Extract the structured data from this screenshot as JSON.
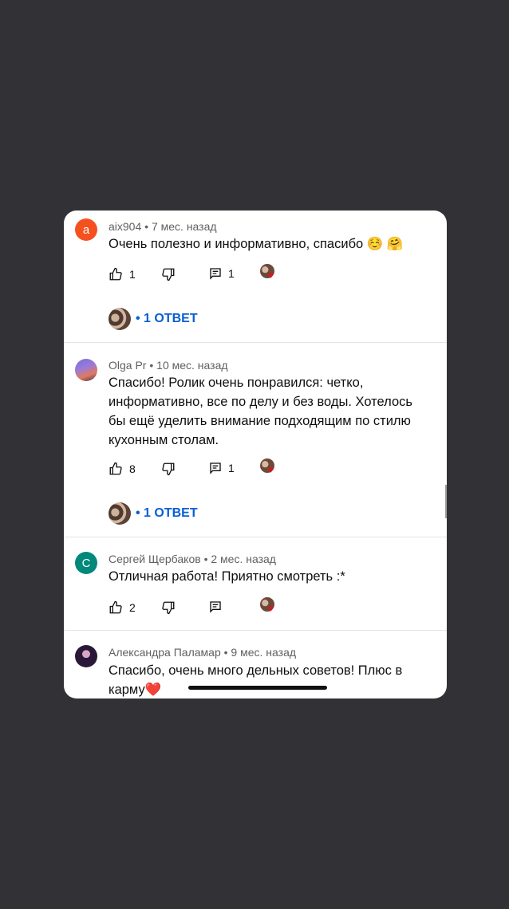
{
  "colors": {
    "background": "#323136",
    "card": "#ffffff",
    "reply_link": "#065fd4",
    "avatar_a": "#f4511e",
    "avatar_c": "#00897b"
  },
  "comments": [
    {
      "avatar_letter": "a",
      "author": "aix904",
      "time": "7 мес. назад",
      "text": "Очень полезно и информативно, спасибо ☺️ 🤗",
      "likes": "1",
      "replies_count": "1",
      "reply_link": "• 1 ОТВЕТ"
    },
    {
      "avatar_letter": "",
      "author": "Olga Pr",
      "time": "10 мес. назад",
      "text": "Спасибо! Ролик очень понравился: четко, информативно, все по делу и без воды. Хотелось бы ещё уделить внимание подходящим по стилю кухонным столам.",
      "likes": "8",
      "replies_count": "1",
      "reply_link": "• 1 ОТВЕТ"
    },
    {
      "avatar_letter": "С",
      "author": "Сергей Щербаков",
      "time": "2 мес. назад",
      "text": "Отличная работа! Приятно смотреть :*",
      "likes": "2",
      "replies_count": ""
    },
    {
      "avatar_letter": "",
      "author": "Александра Паламар",
      "time": "9 мес. назад",
      "text": "Спасибо, очень много дельных советов! Плюс в карму❤️"
    }
  ],
  "separator": "•"
}
